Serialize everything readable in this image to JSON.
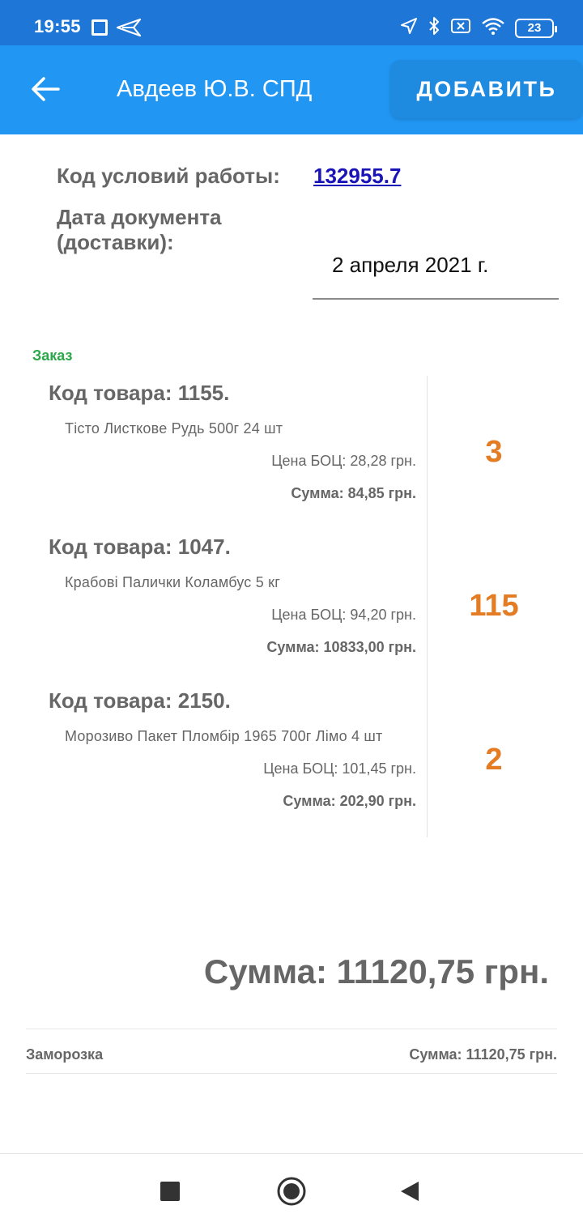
{
  "status_bar": {
    "time": "19:55",
    "battery": "23",
    "icons": [
      "app-icon",
      "send-icon",
      "location-icon",
      "bluetooth-icon",
      "sim-off-icon",
      "wifi-icon",
      "battery-icon"
    ]
  },
  "app_bar": {
    "title": "Авдеев Ю.В. СПД",
    "add_label": "ДОБАВИТЬ",
    "color": "#2196f3"
  },
  "document": {
    "work_code_label": "Код условий работы:",
    "work_code_value": "132955.7",
    "date_label": "Дата документа (доставки):",
    "date_value": "2 апреля 2021 г."
  },
  "order": {
    "section_label": "Заказ",
    "items": [
      {
        "code": "Код товара: 1155.",
        "name": "Тісто Листкове Рудь 500г 24 шт",
        "price": "Цена БОЦ: 28,28 грн.",
        "sum": "Сумма: 84,85 грн.",
        "qty": "3"
      },
      {
        "code": "Код товара: 1047.",
        "name": "Крабові Палички Коламбус 5 кг",
        "price": "Цена БОЦ: 94,20 грн.",
        "sum": "Сумма: 10833,00 грн.",
        "qty": "115"
      },
      {
        "code": "Код товара: 2150.",
        "name": "Морозиво Пакет Пломбір 1965 700г Лімо 4 шт",
        "price": "Цена БОЦ: 101,45 грн.",
        "sum": "Сумма: 202,90 грн.",
        "qty": "2"
      }
    ]
  },
  "totals": {
    "total": "Сумма: 11120,75 грн.",
    "group_name": "Заморозка",
    "group_sum": "Сумма: 11120,75 грн."
  },
  "colors": {
    "accent_qty": "#e47c24",
    "section_green": "#2aa84a",
    "link": "#1a14b8"
  }
}
